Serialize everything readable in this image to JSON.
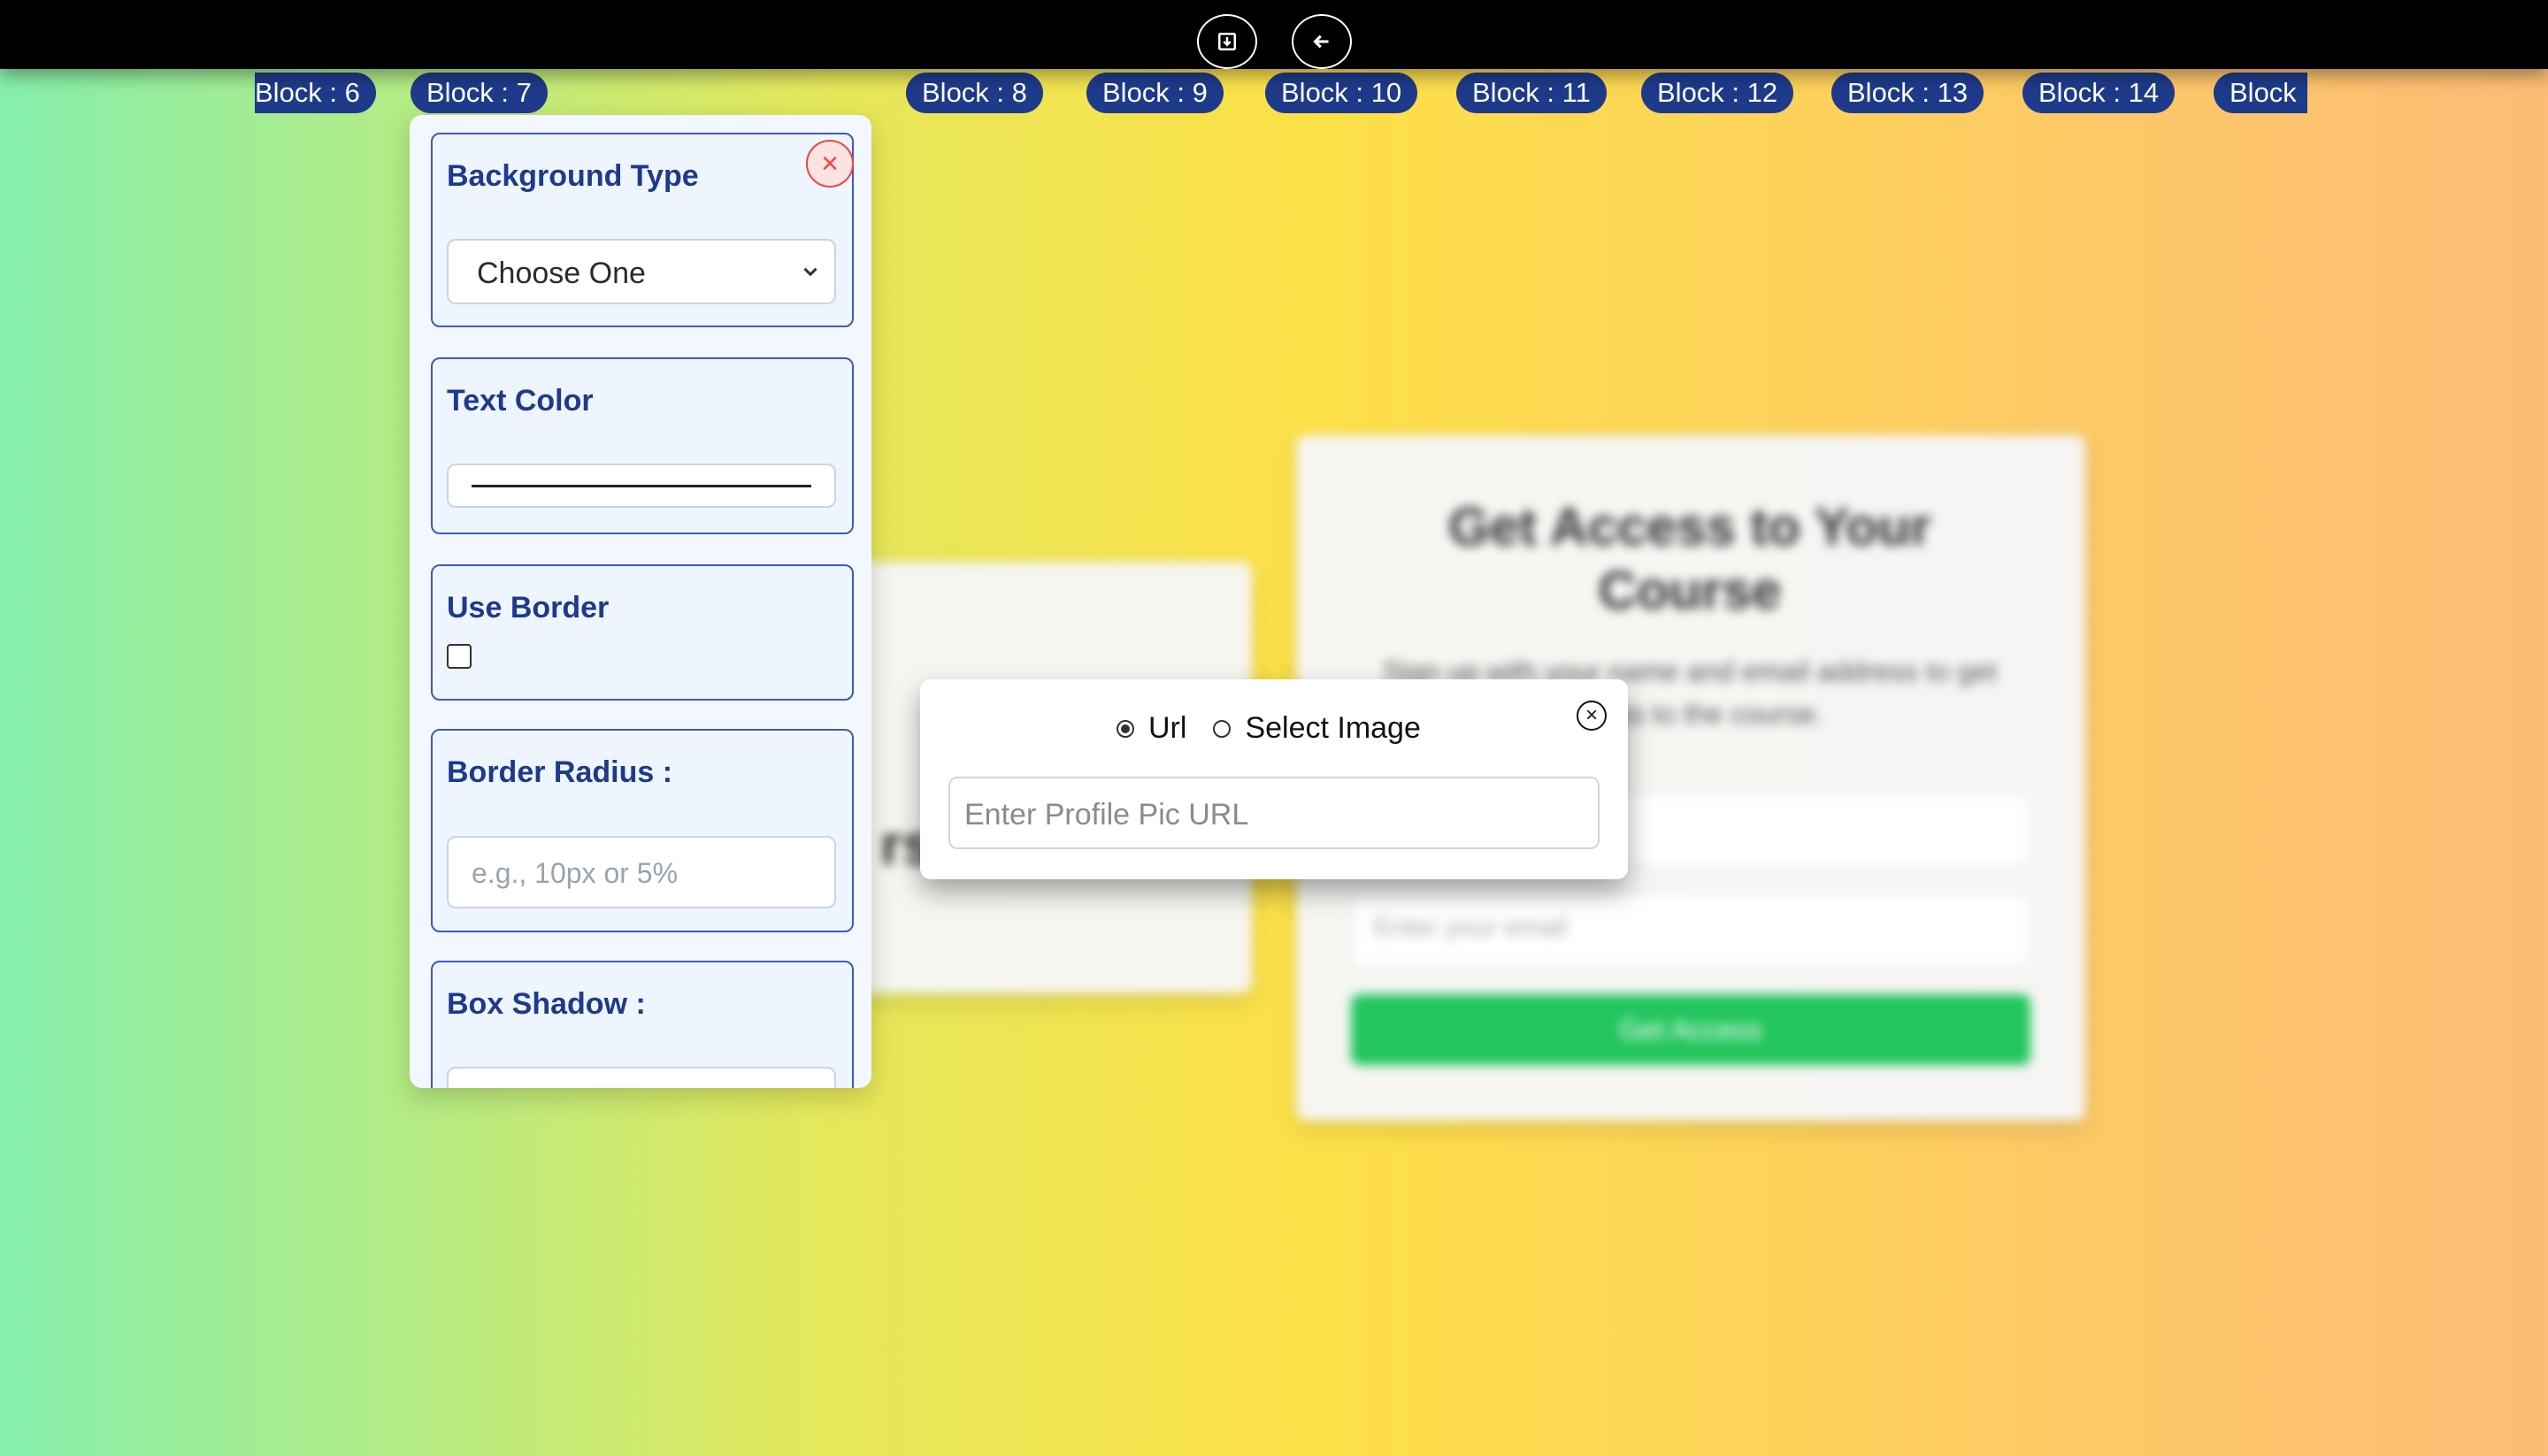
{
  "top_bar": {
    "icons": [
      "save-icon",
      "back-arrow-icon"
    ]
  },
  "chips": [
    {
      "label": "Block : 6"
    },
    {
      "label": "Block : 7"
    },
    {
      "label": "Block : 8"
    },
    {
      "label": "Block : 9"
    },
    {
      "label": "Block : 10"
    },
    {
      "label": "Block : 11"
    },
    {
      "label": "Block : 12"
    },
    {
      "label": "Block : 13"
    },
    {
      "label": "Block : 14"
    },
    {
      "label": "Block"
    }
  ],
  "panel": {
    "close_icon": "close-icon",
    "sections": [
      {
        "title": "Background Type",
        "select_value": "Choose One"
      },
      {
        "title": "Text Color"
      },
      {
        "title": "Use Border",
        "checked": false
      },
      {
        "title": "Border Radius :",
        "placeholder": "e.g., 10px or 5%"
      },
      {
        "title": "Box Shadow :"
      }
    ]
  },
  "background_content": {
    "left_fragment": "rse",
    "card_title": "Get Access to Your Course",
    "card_subtitle": "Sign up with your name and email address to get access to the course.",
    "email_placeholder": "Enter your email",
    "button_label": "Get Access"
  },
  "modal": {
    "option_url": "Url",
    "option_select_image": "Select Image",
    "selected_option": "Url",
    "input_placeholder": "Enter Profile Pic URL",
    "close_icon": "circle-close-icon"
  },
  "colors": {
    "chip_bg": "#1e3a8a",
    "panel_border": "#3b5bbd",
    "primary_button": "#22c55e",
    "close_red": "#ef4444"
  }
}
